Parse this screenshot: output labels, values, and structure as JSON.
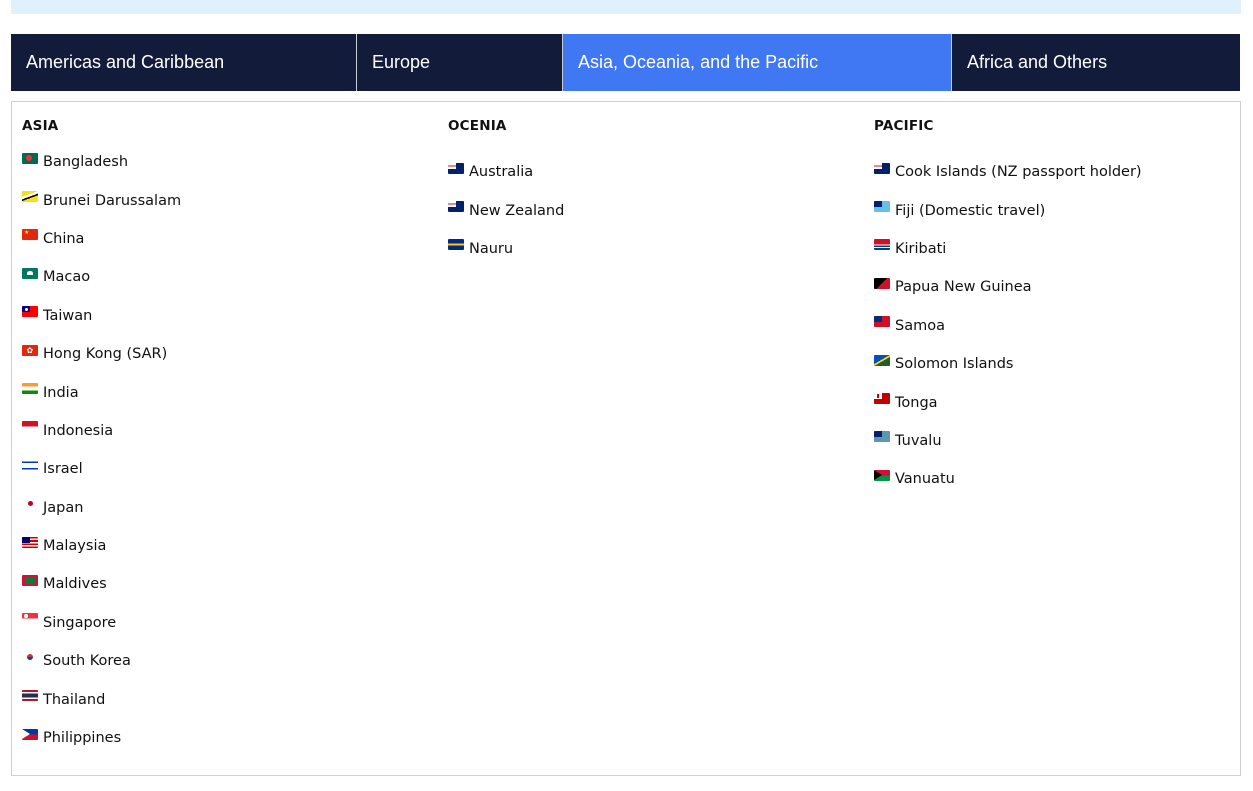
{
  "tabs": [
    {
      "label": "Americas and Caribbean",
      "active": false
    },
    {
      "label": "Europe",
      "active": false
    },
    {
      "label": "Asia, Oceania, and the Pacific",
      "active": true
    },
    {
      "label": "Africa and Others",
      "active": false
    }
  ],
  "columns": [
    {
      "title": "ASIA",
      "items": [
        {
          "label": "Bangladesh",
          "flag": "bangladesh-flag-icon"
        },
        {
          "label": "Brunei Darussalam",
          "flag": "brunei-flag-icon"
        },
        {
          "label": "China",
          "flag": "china-flag-icon"
        },
        {
          "label": "Macao",
          "flag": "macao-flag-icon"
        },
        {
          "label": "Taiwan",
          "flag": "taiwan-flag-icon"
        },
        {
          "label": "Hong Kong (SAR)",
          "flag": "hong-kong-flag-icon"
        },
        {
          "label": "India",
          "flag": "india-flag-icon"
        },
        {
          "label": "Indonesia",
          "flag": "indonesia-flag-icon"
        },
        {
          "label": "Israel",
          "flag": "israel-flag-icon"
        },
        {
          "label": "Japan",
          "flag": "japan-flag-icon"
        },
        {
          "label": "Malaysia",
          "flag": "malaysia-flag-icon"
        },
        {
          "label": "Maldives",
          "flag": "maldives-flag-icon"
        },
        {
          "label": "Singapore",
          "flag": "singapore-flag-icon"
        },
        {
          "label": "South Korea",
          "flag": "south-korea-flag-icon"
        },
        {
          "label": "Thailand",
          "flag": "thailand-flag-icon"
        },
        {
          "label": "Philippines",
          "flag": "philippines-flag-icon"
        }
      ]
    },
    {
      "title": "OCENIA",
      "items": [
        {
          "label": "Australia",
          "flag": "australia-flag-icon"
        },
        {
          "label": "New Zealand",
          "flag": "new-zealand-flag-icon"
        },
        {
          "label": "Nauru",
          "flag": "nauru-flag-icon"
        }
      ]
    },
    {
      "title": "PACIFIC",
      "items": [
        {
          "label": "Cook Islands (NZ passport holder)",
          "flag": "cook-islands-flag-icon"
        },
        {
          "label": "Fiji (Domestic travel)",
          "flag": "fiji-flag-icon"
        },
        {
          "label": "Kiribati",
          "flag": "kiribati-flag-icon"
        },
        {
          "label": "Papua New Guinea",
          "flag": "papua-new-guinea-flag-icon"
        },
        {
          "label": "Samoa",
          "flag": "samoa-flag-icon"
        },
        {
          "label": "Solomon Islands",
          "flag": "solomon-islands-flag-icon"
        },
        {
          "label": "Tonga",
          "flag": "tonga-flag-icon"
        },
        {
          "label": "Tuvalu",
          "flag": "tuvalu-flag-icon"
        },
        {
          "label": "Vanuatu",
          "flag": "vanuatu-flag-icon"
        }
      ]
    }
  ],
  "colors": {
    "tab_bar": "#121b3a",
    "tab_active": "#4078f3",
    "banner": "#dff1fc",
    "panel_border": "#d0d0d0"
  }
}
